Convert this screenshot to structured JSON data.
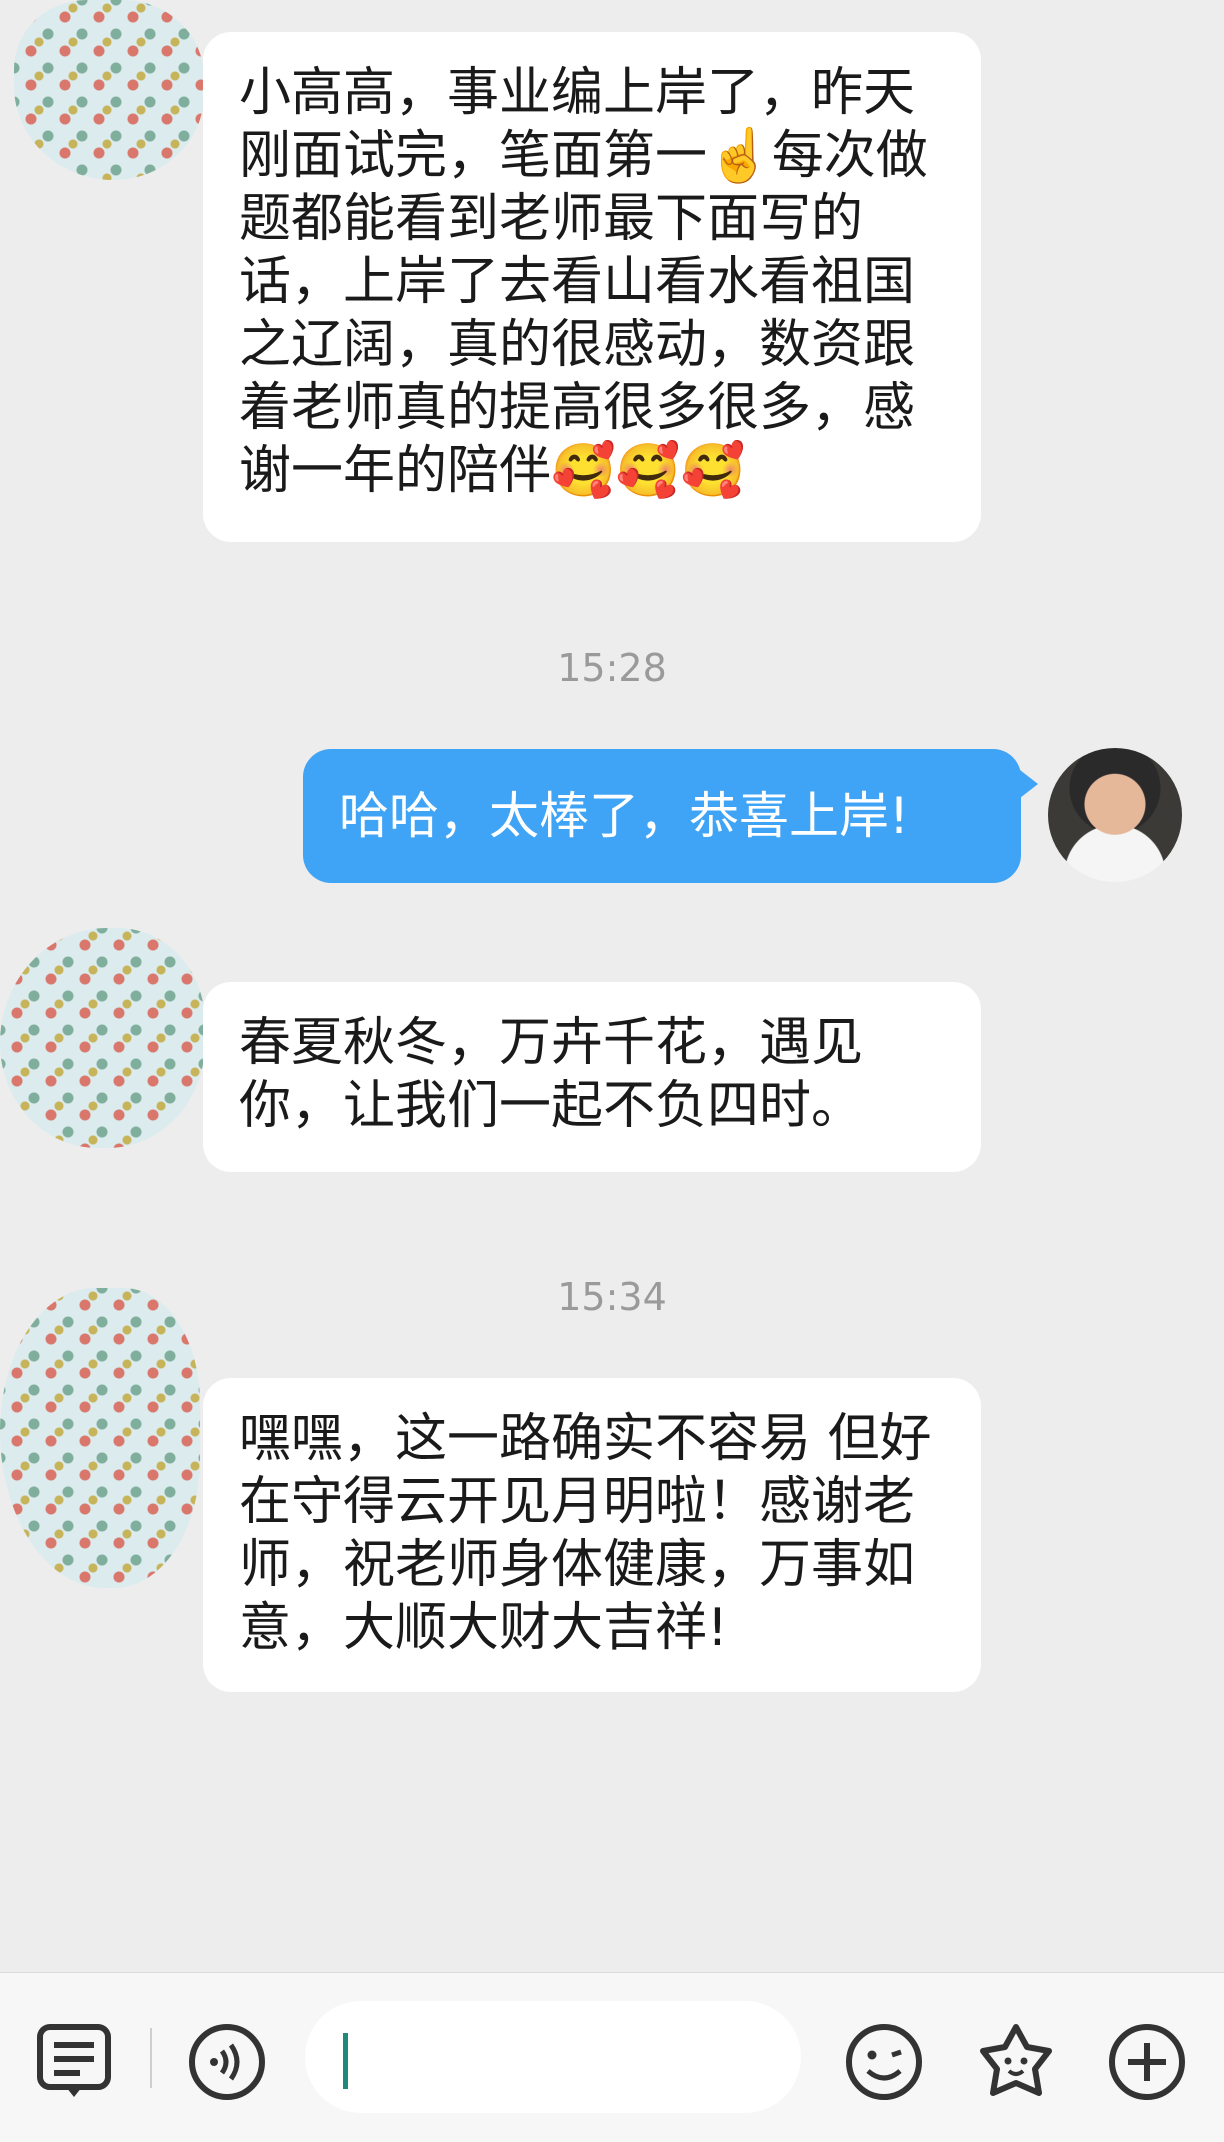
{
  "messages": [
    {
      "side": "incoming",
      "text": "小高高，事业编上岸了，昨天刚面试完，笔面第一☝️每次做题都能看到老师最下面写的话，上岸了去看山看水看祖国之辽阔，真的很感动，数资跟着老师真的提高很多很多，感谢一年的陪伴🥰🥰🥰"
    },
    {
      "side": "time",
      "text": "15:28"
    },
    {
      "side": "outgoing",
      "text": "哈哈，太棒了，恭喜上岸!"
    },
    {
      "side": "incoming",
      "text": "春夏秋冬，万卉千花，遇见你，让我们一起不负四时。"
    },
    {
      "side": "time",
      "text": "15:34"
    },
    {
      "side": "incoming",
      "text": "嘿嘿，这一路确实不容易 但好在守得云开见月明啦！感谢老师，祝老师身体健康，万事如意，大顺大财大吉祥!"
    }
  ],
  "toolbar": {
    "icons": [
      "menu-icon",
      "voice-icon",
      "emoji-icon",
      "sticker-icon",
      "plus-icon"
    ],
    "input_value": ""
  },
  "colors": {
    "outgoing": "#3fa3f6",
    "background": "#ededed",
    "bubble": "#ffffff",
    "time": "#9a9a9a"
  }
}
